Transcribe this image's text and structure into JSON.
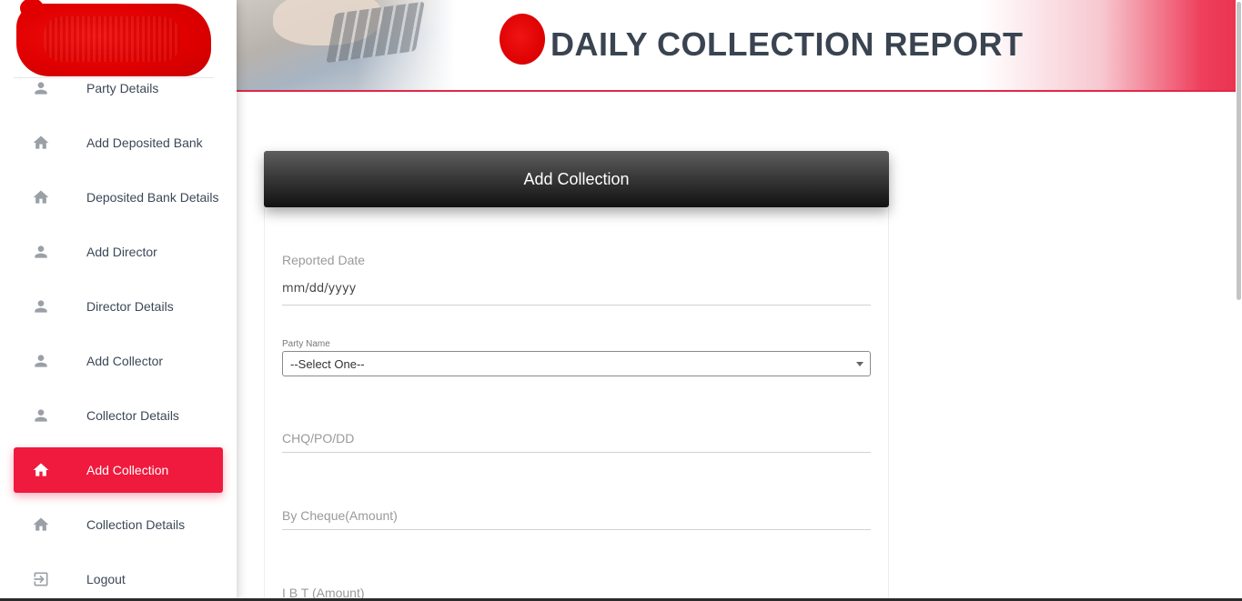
{
  "header": {
    "title": "DAILY COLLECTION REPORT",
    "accent_color": "#ef1a3d"
  },
  "sidebar": {
    "items": [
      {
        "label": "Party Details",
        "icon": "person-icon",
        "active": false
      },
      {
        "label": "Add Deposited Bank",
        "icon": "home-icon",
        "active": false
      },
      {
        "label": "Deposited Bank Details",
        "icon": "home-icon",
        "active": false
      },
      {
        "label": "Add Director",
        "icon": "person-icon",
        "active": false
      },
      {
        "label": "Director Details",
        "icon": "person-icon",
        "active": false
      },
      {
        "label": "Add Collector",
        "icon": "person-icon",
        "active": false
      },
      {
        "label": "Collector Details",
        "icon": "person-icon",
        "active": false
      },
      {
        "label": "Add Collection",
        "icon": "home-icon",
        "active": true
      },
      {
        "label": "Collection Details",
        "icon": "home-icon",
        "active": false
      },
      {
        "label": "Logout",
        "icon": "logout-icon",
        "active": false
      }
    ]
  },
  "form": {
    "title": "Add Collection",
    "reported_date": {
      "label": "Reported Date",
      "value": "mm/dd/yyyy"
    },
    "party_name": {
      "label": "Party Name",
      "selected": "--Select One--"
    },
    "chq": {
      "placeholder": "CHQ/PO/DD"
    },
    "cheque_amount": {
      "placeholder": "By Cheque(Amount)"
    },
    "ibt_amount": {
      "placeholder": "I B T (Amount)"
    }
  }
}
